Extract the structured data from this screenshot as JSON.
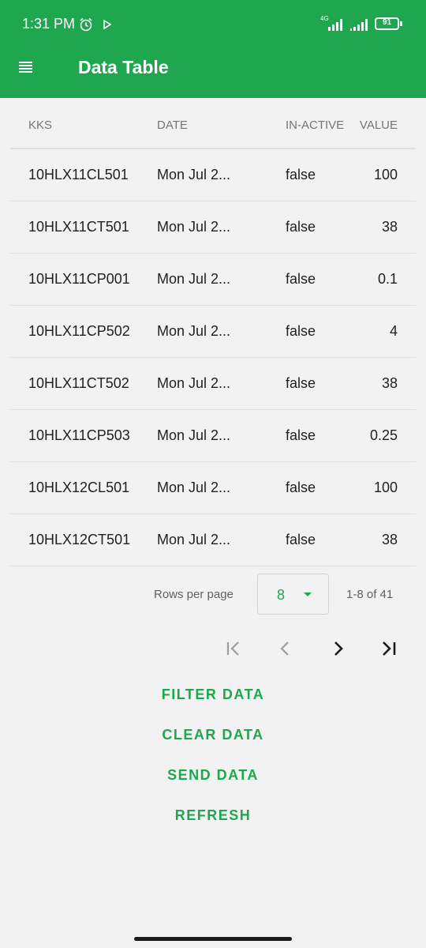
{
  "status_bar": {
    "time": "1:31 PM",
    "network": "4G",
    "battery": "91"
  },
  "app_bar": {
    "title": "Data Table"
  },
  "table": {
    "headers": [
      "KKS",
      "DATE",
      "IN-ACTIVE",
      "VALUE"
    ],
    "rows": [
      {
        "kks": "10HLX11CL501",
        "date": "Mon Jul 2...",
        "inactive": "false",
        "value": "100"
      },
      {
        "kks": "10HLX11CT501",
        "date": "Mon Jul 2...",
        "inactive": "false",
        "value": "38"
      },
      {
        "kks": "10HLX11CP001",
        "date": "Mon Jul 2...",
        "inactive": "false",
        "value": "0.1"
      },
      {
        "kks": "10HLX11CP502",
        "date": "Mon Jul 2...",
        "inactive": "false",
        "value": "4"
      },
      {
        "kks": "10HLX11CT502",
        "date": "Mon Jul 2...",
        "inactive": "false",
        "value": "38"
      },
      {
        "kks": "10HLX11CP503",
        "date": "Mon Jul 2...",
        "inactive": "false",
        "value": "0.25"
      },
      {
        "kks": "10HLX12CL501",
        "date": "Mon Jul 2...",
        "inactive": "false",
        "value": "100"
      },
      {
        "kks": "10HLX12CT501",
        "date": "Mon Jul 2...",
        "inactive": "false",
        "value": "38"
      }
    ]
  },
  "pagination": {
    "rows_per_page_label": "Rows per page",
    "rows_per_page_value": "8",
    "range": "1-8 of 41",
    "icons": [
      "first-page-icon",
      "previous-page-icon",
      "next-page-icon",
      "last-page-icon"
    ]
  },
  "actions": {
    "filter": "FILTER DATA",
    "clear": "CLEAR DATA",
    "send": "SEND DATA",
    "refresh": "REFRESH"
  },
  "colors": {
    "accent": "#1fa750",
    "background": "#f2f2f2",
    "disabled": "#9e9e9e"
  }
}
